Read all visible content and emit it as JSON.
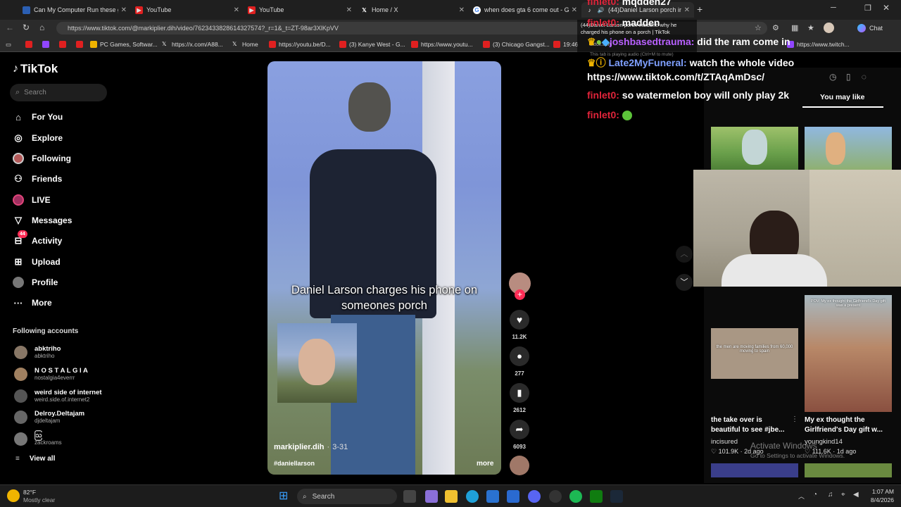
{
  "browser": {
    "tabs": [
      {
        "title": "Can My Computer Run these gam",
        "favicon_color": "#2b5fb3"
      },
      {
        "title": "YouTube",
        "favicon_color": "#e02020"
      },
      {
        "title": "YouTube",
        "favicon_color": "#e02020"
      },
      {
        "title": "Home / X",
        "favicon_color": "#000000"
      },
      {
        "title": "when does gta 6 come out - Goo",
        "favicon_color": "#ffffff"
      },
      {
        "title": "(44)Daniel Larson porch incid",
        "favicon_color": "#000000"
      }
    ],
    "new_tab_label": "+",
    "url": "https://www.tiktok.com/@markiplier.dih/video/7623433828614327574?_r=1&_t=ZT-98ar3XlKpVV",
    "chat_label": "Chat",
    "bookmarks": [
      {
        "label": "",
        "color": "#e02020"
      },
      {
        "label": "",
        "color": "#9146ff"
      },
      {
        "label": "",
        "color": "#e02020"
      },
      {
        "label": "",
        "color": "#e02020"
      },
      {
        "label": "PC Games, Softwar...",
        "color": "#f0b400"
      },
      {
        "label": "https://x.com/A88...",
        "color": "#000000"
      },
      {
        "label": "Home",
        "color": "#000000"
      },
      {
        "label": "https://youtu.be/D...",
        "color": "#e02020"
      },
      {
        "label": "(3) Kanye West - G...",
        "color": "#e02020"
      },
      {
        "label": "https://www.youtu...",
        "color": "#e02020"
      },
      {
        "label": "(3) Chicago Gangst...",
        "color": "#e02020"
      },
      {
        "label": "19:46",
        "color": "#e02020"
      },
      {
        "label": "https://www.twitch...",
        "color": "#9146ff"
      }
    ],
    "tooltip": {
      "title": "(44)Daniel Larson porch incident: why he charged his phone on a porch | TikTok",
      "domain": "tiktok.com",
      "note": "This tab is playing audio (Ctrl+M to mute)"
    }
  },
  "sidebar": {
    "logo": "TikTok",
    "search_placeholder": "Search",
    "nav": [
      {
        "label": "For You",
        "icon": "home-icon"
      },
      {
        "label": "Explore",
        "icon": "compass-icon"
      },
      {
        "label": "Following",
        "icon": "avatar-icon"
      },
      {
        "label": "Friends",
        "icon": "friends-icon"
      },
      {
        "label": "LIVE",
        "icon": "live-icon"
      },
      {
        "label": "Messages",
        "icon": "send-icon"
      },
      {
        "label": "Activity",
        "icon": "inbox-icon",
        "badge": "44"
      },
      {
        "label": "Upload",
        "icon": "plus-square-icon"
      },
      {
        "label": "Profile",
        "icon": "profile-icon"
      },
      {
        "label": "More",
        "icon": "more-icon"
      }
    ],
    "following_title": "Following accounts",
    "accounts": [
      {
        "name": "abktriho",
        "handle": "abktriho",
        "color": "#887766"
      },
      {
        "name": "N O S T A L G I A",
        "handle": "nostalgia4everrr",
        "color": "#a08060"
      },
      {
        "name": "weird side of internet",
        "handle": "weird.side.of.internet2",
        "color": "#555555"
      },
      {
        "name": "Delroy.Deltajam",
        "handle": "djdeltajam",
        "color": "#666666"
      },
      {
        "name": "ဩ",
        "handle": "zackroams",
        "color": "#777777"
      }
    ],
    "view_all": "View all"
  },
  "video": {
    "caption": "Daniel Larson charges his phone on someones porch",
    "author": "markiplier.dih",
    "date": "3-31",
    "hashtag": "#daniellarson",
    "more": "more"
  },
  "actions": [
    {
      "icon": "heart-icon",
      "count": "11.2K"
    },
    {
      "icon": "comment-icon",
      "count": "277"
    },
    {
      "icon": "bookmark-icon",
      "count": "2612"
    },
    {
      "icon": "share-icon",
      "count": "6093"
    }
  ],
  "chat": [
    {
      "user": "finlet0:",
      "user_color": "#e0243a",
      "message": "mqdden27"
    },
    {
      "user": "finlet0:",
      "user_color": "#e0243a",
      "message": "madden"
    },
    {
      "user": "joshbasedtrauma:",
      "user_color": "#b860ff",
      "message": "did the ram come in"
    },
    {
      "user": "Late2MyFuneral:",
      "user_color": "#7fa0ff",
      "message": "watch the whole video https://www.tiktok.com/t/ZTAqAmDsc/"
    },
    {
      "user": "finlet0:",
      "user_color": "#e0243a",
      "message": "so watermelon boy will only play 2k"
    },
    {
      "user": "finlet0:",
      "user_color": "#e0243a",
      "message": ""
    }
  ],
  "right_panel": {
    "tab_label": "You may like",
    "cards": [
      {
        "title": "the take over is beautiful to see #jbe...",
        "author": "incisured",
        "likes": "101.9K",
        "age": "2d ago",
        "thumb_text": "the men are moving families from 60,000 moving to spain",
        "thumb_color": "#a99784"
      },
      {
        "title": "My ex thought the Girlfriend's Day gift w...",
        "author": "youngkind14",
        "likes": "111.6K",
        "age": "1d ago",
        "thumb_text": "POV: My ex thought the Girlfriend's Day gift was a present",
        "thumb_color": "#b88868"
      }
    ],
    "watermark_title": "Activate Windows",
    "watermark_sub": "Go to Settings to activate Windows."
  },
  "taskbar": {
    "weather_temp": "82°F",
    "weather_desc": "Mostly clear",
    "search_label": "Search",
    "time": "1:07 AM",
    "date": "8/4/2026"
  }
}
